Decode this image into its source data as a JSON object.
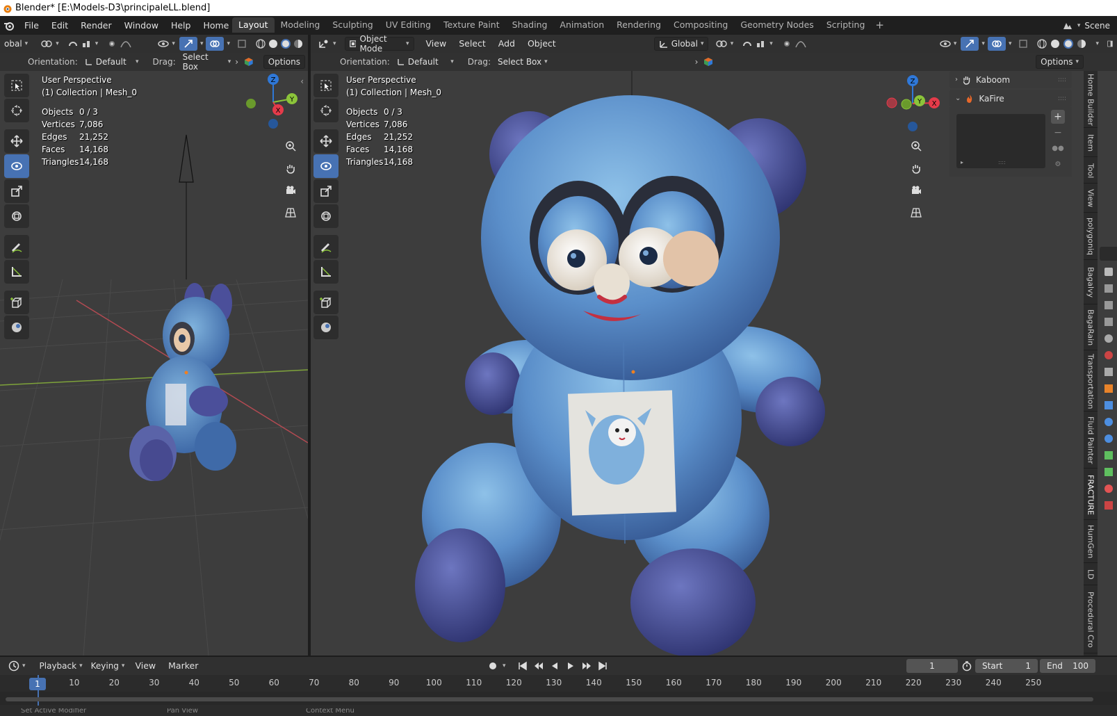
{
  "window": {
    "title": "Blender* [E:\\Models-D3\\principaleLL.blend]"
  },
  "menu": [
    "File",
    "Edit",
    "Render",
    "Window",
    "Help",
    "Home Builder"
  ],
  "workspaces": [
    "Layout",
    "Modeling",
    "Sculpting",
    "UV Editing",
    "Texture Paint",
    "Shading",
    "Animation",
    "Rendering",
    "Compositing",
    "Geometry Nodes",
    "Scripting"
  ],
  "active_workspace": "Layout",
  "scene": {
    "label": "Scene"
  },
  "left_view": {
    "transform_partial": "obal",
    "orientation_label": "Orientation:",
    "orientation_value": "Default",
    "drag_label": "Drag:",
    "drag_value": "Select Box",
    "options_label": "Options",
    "perspective": "User Perspective",
    "collection": "(1) Collection | Mesh_0",
    "stats": {
      "objects_label": "Objects",
      "objects": "0 / 3",
      "vertices_label": "Vertices",
      "vertices": "7,086",
      "edges_label": "Edges",
      "edges": "21,252",
      "faces_label": "Faces",
      "faces": "14,168",
      "triangles_label": "Triangles",
      "triangles": "14,168"
    }
  },
  "main_view": {
    "mode": "Object Mode",
    "menus": [
      "View",
      "Select",
      "Add",
      "Object"
    ],
    "transform_orientation": "Global",
    "orientation_label": "Orientation:",
    "orientation_value": "Default",
    "drag_label": "Drag:",
    "drag_value": "Select Box",
    "options_label": "Options",
    "perspective": "User Perspective",
    "collection": "(1) Collection | Mesh_0",
    "stats": {
      "objects_label": "Objects",
      "objects": "0 / 3",
      "vertices_label": "Vertices",
      "vertices": "7,086",
      "edges_label": "Edges",
      "edges": "21,252",
      "faces_label": "Faces",
      "faces": "14,168",
      "triangles_label": "Triangles",
      "triangles": "14,168"
    },
    "gizmo": {
      "z": "Z",
      "x": "X",
      "y": "Y"
    }
  },
  "npanel": {
    "panels": [
      "Kaboom",
      "KaFire"
    ],
    "tabs": [
      "Home Builder",
      "Item",
      "Tool",
      "View",
      "polygoniq",
      "Bagalvy",
      "BagaRain",
      "Transportation",
      "Fluid Painter",
      "FRACTURE",
      "HumGen",
      "LD",
      "Procedural Cro"
    ]
  },
  "timeline": {
    "menus": [
      "Playback",
      "Keying",
      "View",
      "Marker"
    ],
    "current_frame": "1",
    "start_label": "Start",
    "start": "1",
    "end_label": "End",
    "end": "100",
    "ticks": [
      "1",
      "10",
      "20",
      "30",
      "40",
      "50",
      "60",
      "70",
      "80",
      "90",
      "100",
      "110",
      "120",
      "130",
      "140",
      "150",
      "160",
      "170",
      "180",
      "190",
      "200",
      "210",
      "220",
      "230",
      "240",
      "250"
    ]
  },
  "statusbar": {
    "hints": [
      "Set Active Modifier",
      "Pan View",
      "Context Menu"
    ]
  },
  "colors": {
    "accent": "#4772b3",
    "x_axis": "#e53b4a",
    "y_axis": "#8bc43a",
    "z_axis": "#2f78d8"
  }
}
